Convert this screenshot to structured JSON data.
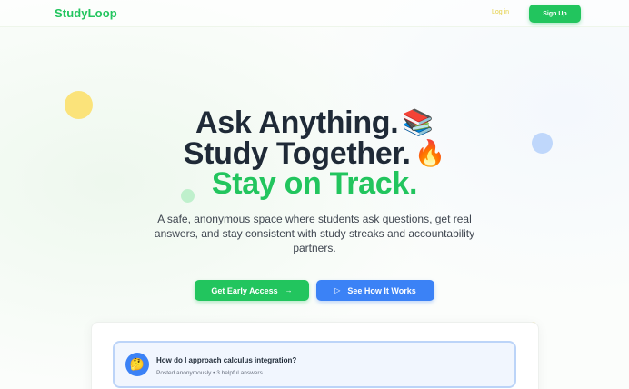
{
  "nav": {
    "logo": "StudyLoop",
    "login_label": "Log in",
    "signup_label": "Sign Up"
  },
  "hero": {
    "line1": "Ask Anything.",
    "line1_emoji": "📚",
    "line2": "Study Together.",
    "line2_emoji": "🔥",
    "line3": "Stay on Track.",
    "subtext": "A safe, anonymous space where students ask questions, get real answers, and stay consistent with study streaks and accountability partners."
  },
  "cta": {
    "primary_label": "Get Early Access",
    "primary_icon": "→",
    "secondary_label": "See How It Works",
    "secondary_icon": "▷"
  },
  "preview": {
    "avatar_emoji": "🤔",
    "question_title": "How do I approach calculus integration?",
    "question_meta": "Posted anonymously • 3 helpful answers"
  },
  "colors": {
    "brand_green": "#22c55e",
    "accent_blue": "#3b82f6",
    "heading": "#1f2a37",
    "login_yellow": "#e4cf43"
  }
}
